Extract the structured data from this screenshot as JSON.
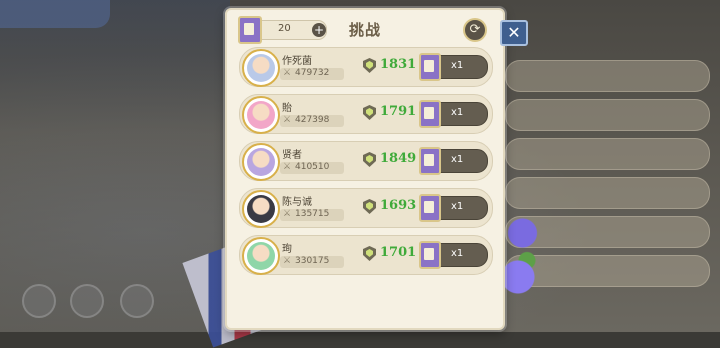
{
  "header": {
    "title": "挑战",
    "ticket_count": "20",
    "plus_glyph": "+",
    "refresh_glyph": "⟳",
    "close_glyph": "✕"
  },
  "opponents": [
    {
      "name": "作死菌",
      "power": "479732",
      "rank": "1831",
      "cost": "x1",
      "avatar_color": "#b9c9e8"
    },
    {
      "name": "貽",
      "power": "427398",
      "rank": "1791",
      "cost": "x1",
      "avatar_color": "#f2a6c8"
    },
    {
      "name": "贤者",
      "power": "410510",
      "rank": "1849",
      "cost": "x1",
      "avatar_color": "#b9a6e0"
    },
    {
      "name": "陈与诚",
      "power": "135715",
      "rank": "1693",
      "cost": "x1",
      "avatar_color": "#3a3a44"
    },
    {
      "name": "珣",
      "power": "330175",
      "rank": "1701",
      "cost": "x1",
      "avatar_color": "#8fd6a8"
    }
  ],
  "icons": {
    "power": "crossed-swords-icon",
    "rank": "shield-badge-icon",
    "ticket": "challenge-ticket-icon"
  },
  "colors": {
    "panel_bg": "#f6f1e3",
    "rank_green": "#3faa3a",
    "button_dark": "#645d50",
    "close_blue": "#3f5f8e"
  }
}
